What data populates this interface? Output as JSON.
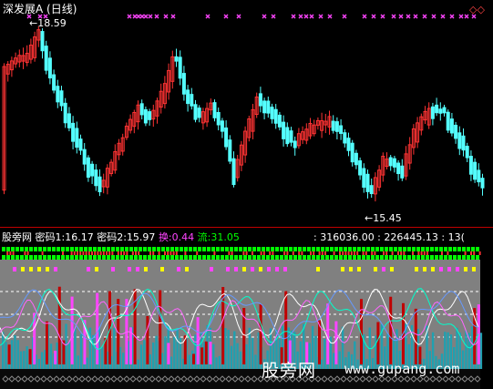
{
  "top_panel": {
    "title": "深发展A (日线)",
    "high_marker": "18.59",
    "low_marker": "15.45",
    "diamond_marker": "◇◇"
  },
  "bottom_panel": {
    "indicator_name": "股旁网",
    "mima1_label": "密码1:",
    "mima1_value": "16.17",
    "mima2_label": "密码2:",
    "mima2_value": "15.97",
    "huan_label": "换:",
    "huan_value": "0.44",
    "liu_label": "流:",
    "liu_value": "31.05",
    "extra_values": ": 316036.00 : 226445.13 : 13("
  },
  "watermark": {
    "brand": "股旁网",
    "url": "www.gupang.com"
  },
  "colors": {
    "up": "#ff3333",
    "down": "#54ffff",
    "magenta": "#ff44ff",
    "yellow": "#ffff00",
    "green": "#00ff00",
    "grey_band": "#808080",
    "teal": "#20a0b0"
  }
}
